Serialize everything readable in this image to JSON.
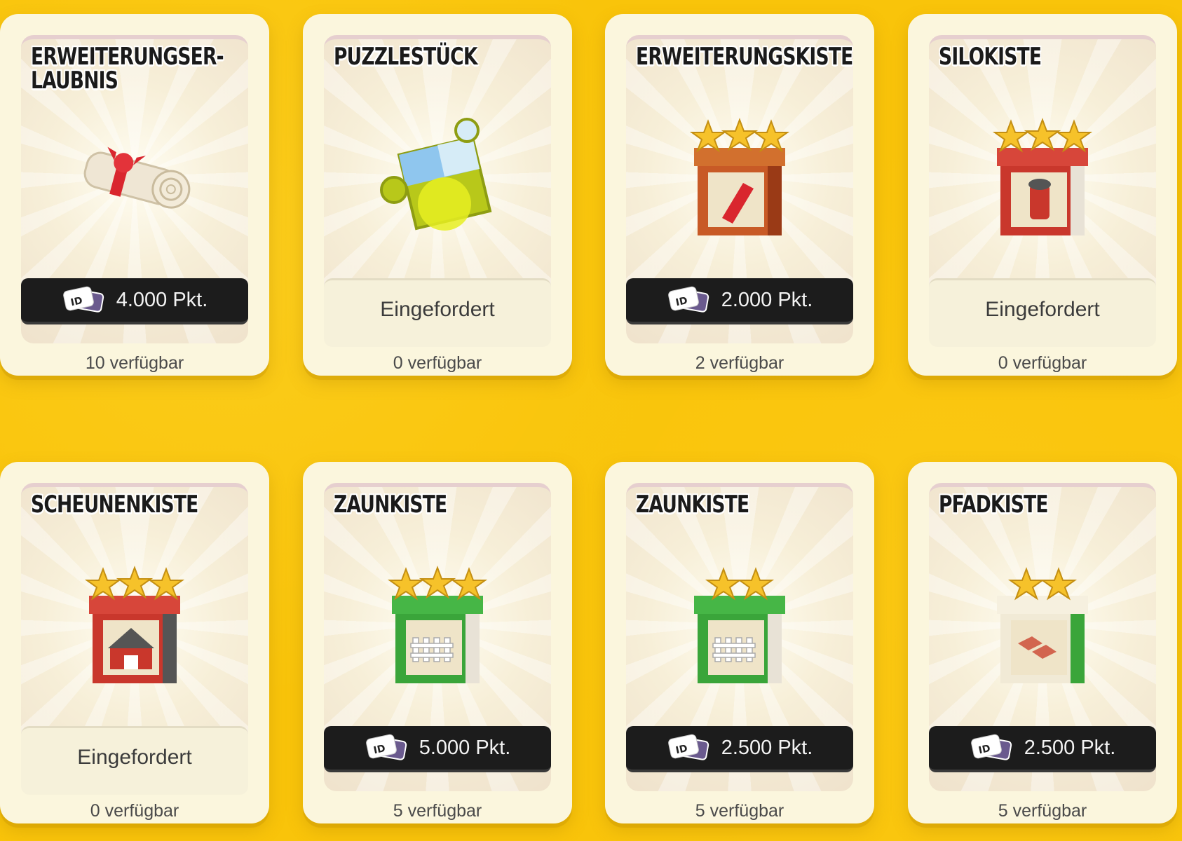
{
  "cards": [
    {
      "title": "ERWEITERUNGSER-\nLAUBNIS",
      "art": "scroll-icon",
      "button": "4.000 Pkt.",
      "claimed": false,
      "available": "10 verfügbar"
    },
    {
      "title": "PUZZLESTÜCK",
      "art": "puzzle-piece-icon",
      "button": "Eingefordert",
      "claimed": true,
      "available": "0 verfügbar"
    },
    {
      "title": "ERWEITERUNGSKISTE",
      "art": "expansion-crate-icon",
      "stars": 3,
      "button": "2.000 Pkt.",
      "claimed": false,
      "available": "2 verfügbar"
    },
    {
      "title": "SILOKISTE",
      "art": "silo-crate-icon",
      "stars": 3,
      "button": "Eingefordert",
      "claimed": true,
      "available": "0 verfügbar"
    },
    {
      "title": "SCHEUNENKISTE",
      "art": "barn-crate-icon",
      "stars": 3,
      "button": "Eingefordert",
      "claimed": true,
      "available": "0 verfügbar"
    },
    {
      "title": "ZAUNKISTE",
      "art": "fence-crate-icon",
      "stars": 3,
      "button": "5.000 Pkt.",
      "claimed": false,
      "available": "5 verfügbar"
    },
    {
      "title": "ZAUNKISTE",
      "art": "fence-crate-icon",
      "stars": 2,
      "button": "2.500 Pkt.",
      "claimed": false,
      "available": "5 verfügbar"
    },
    {
      "title": "PFADKISTE",
      "art": "path-crate-icon",
      "stars": 2,
      "button": "2.500 Pkt.",
      "claimed": false,
      "available": "5 verfügbar"
    }
  ],
  "colors": {
    "background": "#f9c40a",
    "card": "#fbf6dd",
    "button_dark": "#1c1c1c",
    "crate_red": "#c9372c",
    "crate_green": "#3aa53a",
    "crate_white": "#f1ead6"
  }
}
